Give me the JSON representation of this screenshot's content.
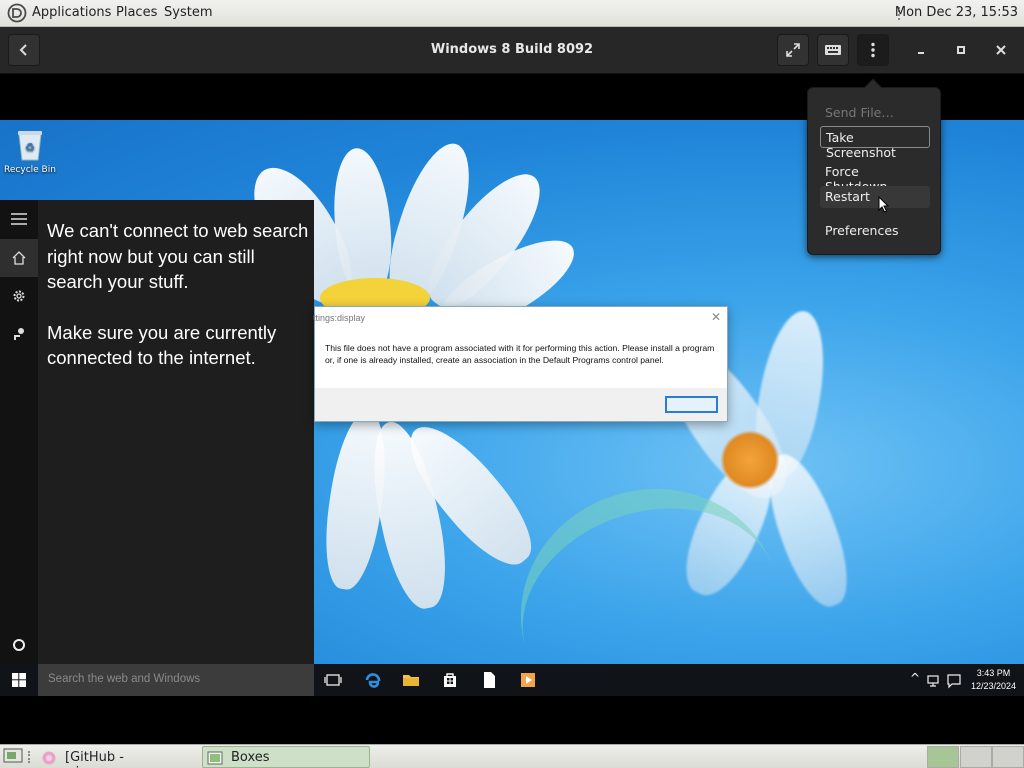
{
  "top_panel": {
    "menus": [
      "Applications",
      "Places",
      "System"
    ],
    "clock": "Mon Dec 23, 15:53"
  },
  "headerbar": {
    "title": "Windows 8 Build 8092",
    "icons": [
      "back-icon",
      "fullscreen-icon",
      "keyboard-icon",
      "menu-icon",
      "minimize-icon",
      "maximize-icon",
      "close-icon"
    ]
  },
  "popover": {
    "items": [
      {
        "label": "Send File…",
        "state": "disabled"
      },
      {
        "label": "Take Screenshot",
        "state": "focused"
      },
      {
        "label": "Force Shutdown",
        "state": "normal"
      },
      {
        "label": "Restart",
        "state": "hover"
      },
      {
        "label": "Preferences",
        "state": "normal"
      }
    ]
  },
  "guest": {
    "desktop_icon": "Recycle Bin",
    "cortana": {
      "message_1": "We can't connect to web search right now but you can still search your stuff.",
      "message_2": "Make sure you are currently connected to the internet."
    },
    "dialog": {
      "title": "ttings:display",
      "message": "This file does not have a program associated with it for performing this action. Please install a program or, if one is already installed, create an association in the Default Programs control panel.",
      "close": "✕"
    },
    "taskbar": {
      "search_placeholder": "Search the web and Windows",
      "time": "3:43 PM",
      "date": "12/23/2024"
    }
  },
  "bottom_panel": {
    "tasks": [
      {
        "label": "[GitHub - winapps-…",
        "active": false
      },
      {
        "label": "Boxes",
        "active": true
      }
    ],
    "workspaces": 3,
    "active_workspace": 0
  }
}
